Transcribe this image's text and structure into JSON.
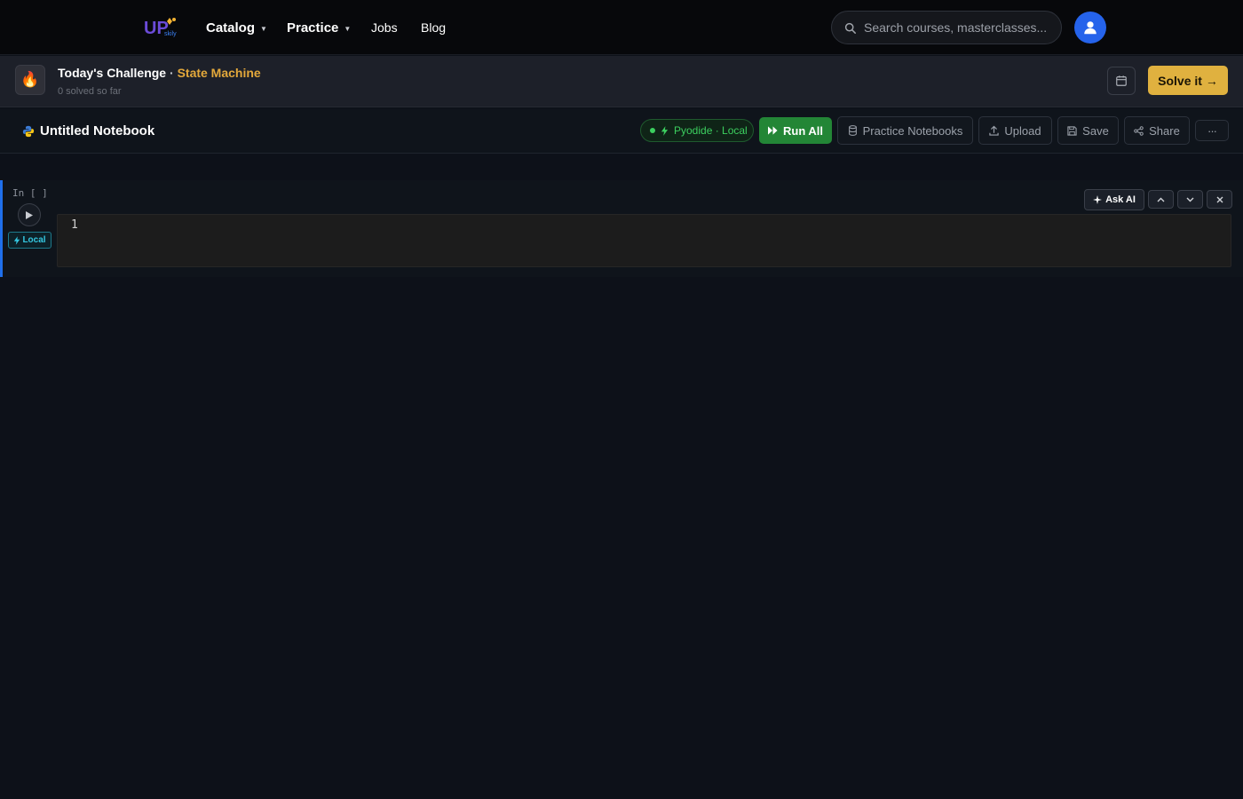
{
  "nav": {
    "logo_text": "UPskilly",
    "items": [
      {
        "label": "Catalog",
        "has_caret": true
      },
      {
        "label": "Practice",
        "has_caret": true
      },
      {
        "label": "Jobs",
        "has_caret": false
      },
      {
        "label": "Blog",
        "has_caret": false
      }
    ],
    "search": {
      "placeholder": "Search courses, masterclasses...",
      "value": ""
    },
    "avatar_icon": "user-icon"
  },
  "challenge": {
    "icon": "fire-icon",
    "title": "Today's Challenge",
    "separator": " · ",
    "name": "State Machine",
    "subtitle": "0 solved so far",
    "calendar_icon": "calendar-icon",
    "solve_label": "Solve it →"
  },
  "toolbar": {
    "notebook_title": "Untitled Notebook",
    "kernel_label": "Pyodide · Local",
    "run_all_label": "Run All",
    "practice_label": "Practice Notebooks",
    "upload_label": "Upload",
    "save_label": "Save",
    "share_label": "Share",
    "more_label": "···"
  },
  "cell": {
    "prompt": "In [ ]",
    "badge_label": "Local",
    "line_number": "1",
    "code": "",
    "ask_ai_label": "Ask AI"
  },
  "colors": {
    "accent_blue": "#1f6feb",
    "run_green": "#238636",
    "challenge_gold": "#e0b13f",
    "kernel_green": "#3ccf5f",
    "local_cyan": "#34c7e0"
  }
}
